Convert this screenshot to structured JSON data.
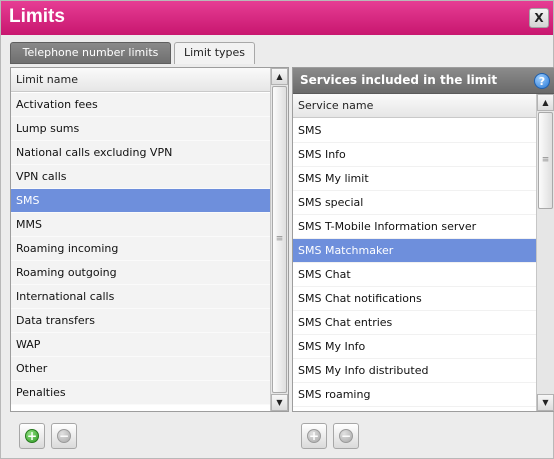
{
  "window": {
    "title": "Limits",
    "close_label": "X"
  },
  "tabs": [
    {
      "label": "Telephone number limits",
      "active": true
    },
    {
      "label": "Limit types",
      "active": false
    }
  ],
  "left_panel": {
    "column_header": "Limit name",
    "selected_index": 4,
    "items": [
      "Activation fees",
      "Lump sums",
      "National calls excluding VPN",
      "VPN calls",
      "SMS",
      "MMS",
      "Roaming incoming",
      "Roaming outgoing",
      "International calls",
      "Data transfers",
      "WAP",
      "Other",
      "Penalties"
    ]
  },
  "right_panel": {
    "section_title": "Services included in the limit",
    "help_label": "?",
    "column_header": "Service name",
    "selected_index": 5,
    "items": [
      "SMS",
      "SMS Info",
      "SMS My limit",
      "SMS special",
      "SMS T-Mobile Information server",
      "SMS Matchmaker",
      "SMS Chat",
      "SMS Chat notifications",
      "SMS Chat entries",
      "SMS My Info",
      "SMS My Info distributed",
      "SMS roaming"
    ]
  },
  "icons": {
    "add": "plus-circle-icon",
    "remove": "minus-circle-icon",
    "help": "question-circle-icon"
  },
  "colors": {
    "title_bar": "#d32a82",
    "selection": "#6e8fdc",
    "panel_header": "#7a7a7a"
  }
}
